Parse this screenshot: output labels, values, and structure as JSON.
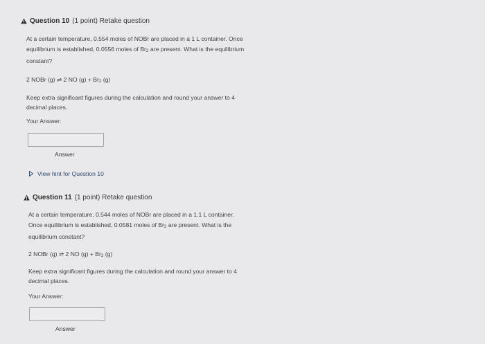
{
  "questions": [
    {
      "title": "Question 10",
      "meta": "(1 point) Retake question",
      "text_lines": [
        "At a certain temperature, 0.554 moles of NOBr are placed in a 1 L container. Once",
        "equilibrium is established, 0.0556 moles of Br",
        "constant?"
      ],
      "text_line2_tail": " are present. What is the equilibrium",
      "equation_left": "2 NOBr (g)",
      "equation_arrow": "⇌",
      "equation_right": "2 NO (g) + Br",
      "equation_tail": " (g)",
      "instruction_lines": [
        "Keep extra significant figures during the calculation and round your answer to 4",
        "decimal places."
      ],
      "your_answer_label": "Your Answer:",
      "answer_value": "",
      "answer_label": "Answer",
      "hint": "View hint for Question 10"
    },
    {
      "title": "Question 11",
      "meta": "(1 point) Retake question",
      "text_lines": [
        "At a certain temperature, 0.544 moles of NOBr are placed in a 1.1 L container.",
        "Once equilibrium is established, 0.0581 moles of Br",
        "equilibrium constant?"
      ],
      "text_line2_tail": " are present. What is the",
      "equation_left": "2 NOBr (g)",
      "equation_arrow": "⇌",
      "equation_right": "2 NO (g) + Br",
      "equation_tail": " (g)",
      "instruction_lines": [
        "Keep extra significant figures during the calculation and round your answer to 4",
        "decimal places."
      ],
      "your_answer_label": "Your Answer:",
      "answer_value": "",
      "answer_label": "Answer"
    }
  ],
  "subscript": "2",
  "colors": {
    "warning_icon": "#2b2b2b",
    "hint_link": "#2f4b73"
  }
}
